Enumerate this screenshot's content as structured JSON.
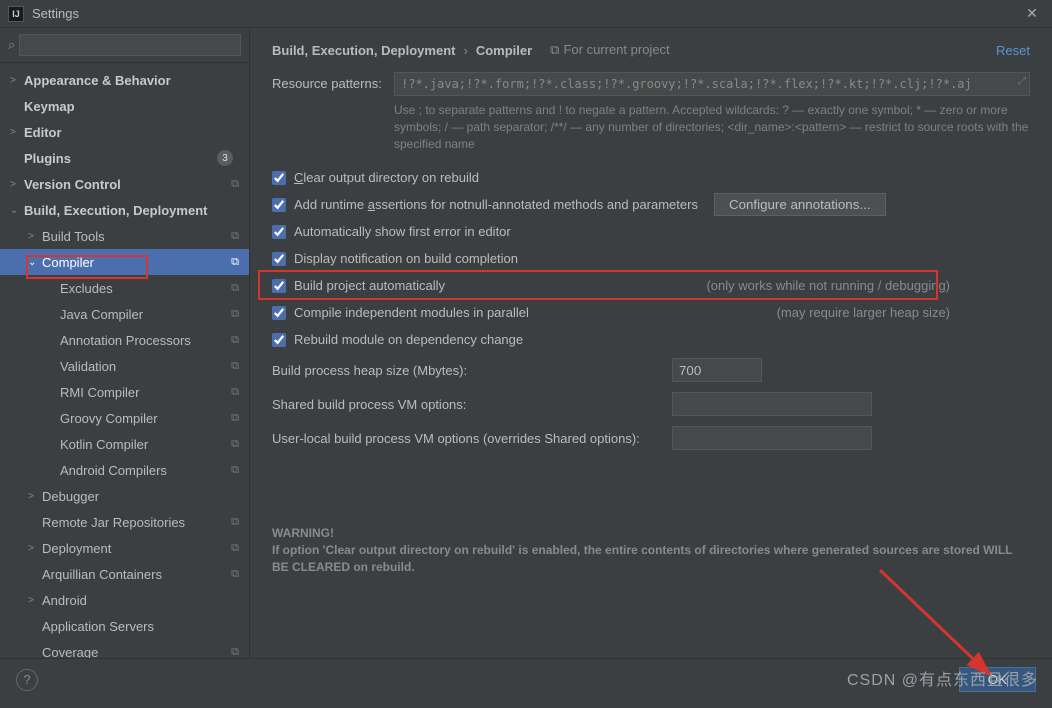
{
  "titlebar": {
    "title": "Settings",
    "close": "✕",
    "app_glyph": "IJ"
  },
  "search": {
    "placeholder": "",
    "glyph": "⌕"
  },
  "tree": [
    {
      "label": "Appearance & Behavior",
      "depth": 0,
      "arrow": ">",
      "bold": true
    },
    {
      "label": "Keymap",
      "depth": 0,
      "arrow": "",
      "bold": true
    },
    {
      "label": "Editor",
      "depth": 0,
      "arrow": ">",
      "bold": true
    },
    {
      "label": "Plugins",
      "depth": 0,
      "arrow": "",
      "bold": true,
      "badge": "3"
    },
    {
      "label": "Version Control",
      "depth": 0,
      "arrow": ">",
      "bold": true,
      "copy": true
    },
    {
      "label": "Build, Execution, Deployment",
      "depth": 0,
      "arrow": "⌄",
      "bold": true
    },
    {
      "label": "Build Tools",
      "depth": 1,
      "arrow": ">",
      "copy": true
    },
    {
      "label": "Compiler",
      "depth": 1,
      "arrow": "⌄",
      "copy": true,
      "selected": true
    },
    {
      "label": "Excludes",
      "depth": 2,
      "arrow": "",
      "copy": true
    },
    {
      "label": "Java Compiler",
      "depth": 2,
      "arrow": "",
      "copy": true
    },
    {
      "label": "Annotation Processors",
      "depth": 2,
      "arrow": "",
      "copy": true
    },
    {
      "label": "Validation",
      "depth": 2,
      "arrow": "",
      "copy": true
    },
    {
      "label": "RMI Compiler",
      "depth": 2,
      "arrow": "",
      "copy": true
    },
    {
      "label": "Groovy Compiler",
      "depth": 2,
      "arrow": "",
      "copy": true
    },
    {
      "label": "Kotlin Compiler",
      "depth": 2,
      "arrow": "",
      "copy": true
    },
    {
      "label": "Android Compilers",
      "depth": 2,
      "arrow": "",
      "copy": true
    },
    {
      "label": "Debugger",
      "depth": 1,
      "arrow": ">"
    },
    {
      "label": "Remote Jar Repositories",
      "depth": 1,
      "arrow": "",
      "copy": true
    },
    {
      "label": "Deployment",
      "depth": 1,
      "arrow": ">",
      "copy": true
    },
    {
      "label": "Arquillian Containers",
      "depth": 1,
      "arrow": "",
      "copy": true
    },
    {
      "label": "Android",
      "depth": 1,
      "arrow": ">"
    },
    {
      "label": "Application Servers",
      "depth": 1,
      "arrow": ""
    },
    {
      "label": "Coverage",
      "depth": 1,
      "arrow": "",
      "copy": true
    }
  ],
  "crumb": {
    "a": "Build, Execution, Deployment",
    "b": "Compiler",
    "for": "For current project",
    "reset": "Reset"
  },
  "patterns": {
    "label": "Resource patterns:",
    "value": "!?*.java;!?*.form;!?*.class;!?*.groovy;!?*.scala;!?*.flex;!?*.kt;!?*.clj;!?*.aj",
    "hint": "Use ; to separate patterns and ! to negate a pattern. Accepted wildcards: ? — exactly one symbol; * — zero or more symbols; / — path separator; /**/ — any number of directories; <dir_name>:<pattern> — restrict to source roots with the specified name"
  },
  "checks": {
    "c1": "Clear output directory on rebuild",
    "c2": "Add runtime assertions for notnull-annotated methods and parameters",
    "c2btn": "Configure annotations...",
    "c3": "Automatically show first error in editor",
    "c4": "Display notification on build completion",
    "c5": "Build project automatically",
    "c5note": "(only works while not running / debugging)",
    "c6": "Compile independent modules in parallel",
    "c6note": "(may require larger heap size)",
    "c7": "Rebuild module on dependency change"
  },
  "opts": {
    "heap_label": "Build process heap size (Mbytes):",
    "heap_value": "700",
    "shared_label": "Shared build process VM options:",
    "shared_value": "",
    "user_label": "User-local build process VM options (overrides Shared options):",
    "user_value": ""
  },
  "warn": {
    "title": "WARNING!",
    "body": "If option 'Clear output directory on rebuild' is enabled, the entire contents of directories where generated sources are stored WILL BE CLEARED on rebuild."
  },
  "footer": {
    "ok": "OK",
    "help": "?"
  },
  "watermark": "CSDN @有点东西且很多"
}
